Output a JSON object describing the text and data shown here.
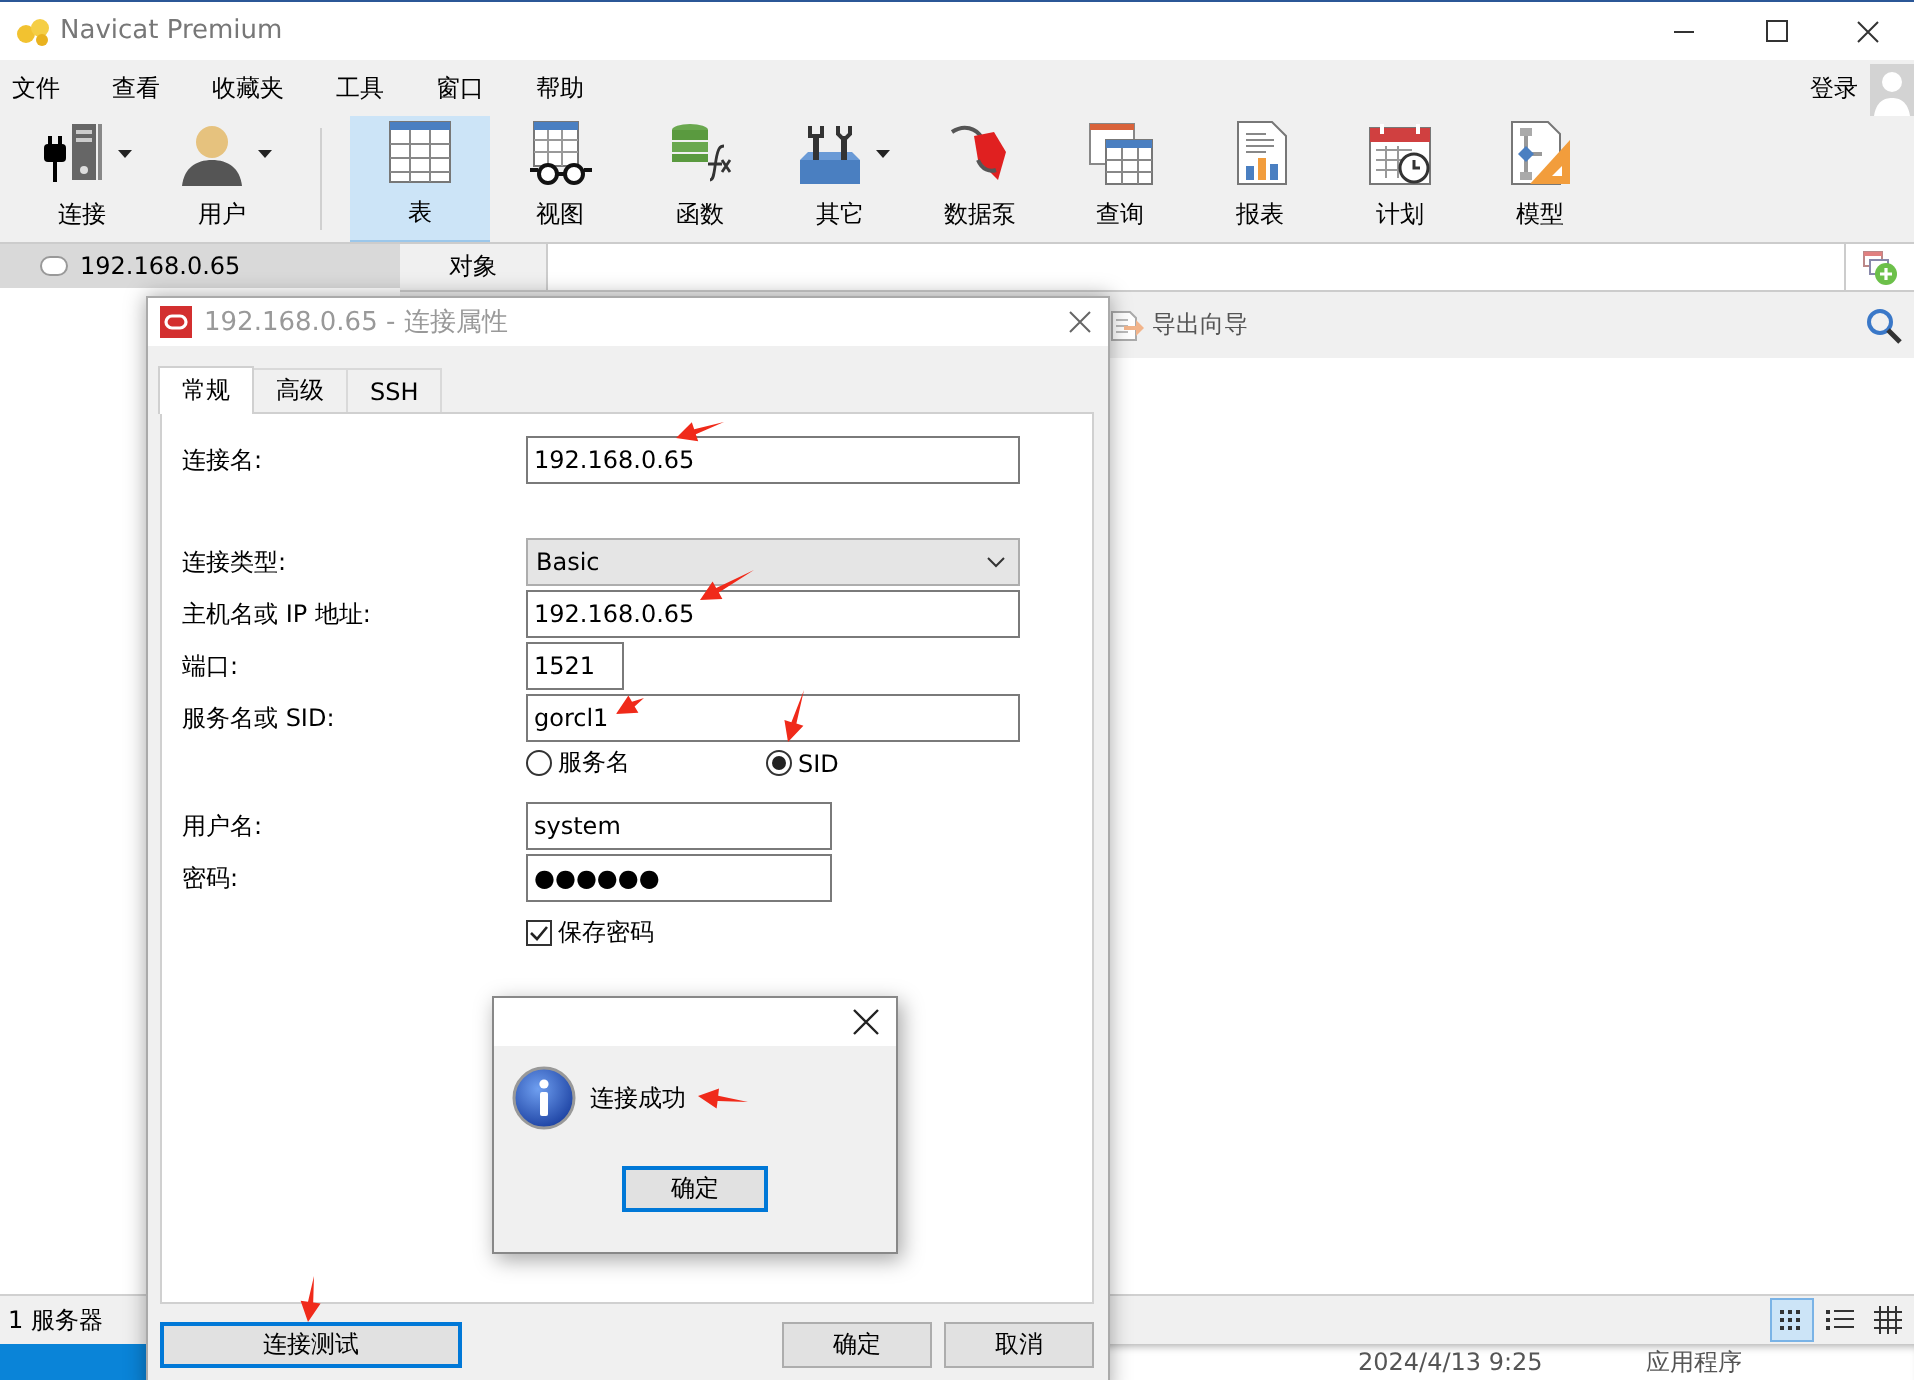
{
  "window": {
    "title": "Navicat Premium"
  },
  "menu": [
    "文件",
    "查看",
    "收藏夹",
    "工具",
    "窗口",
    "帮助"
  ],
  "login": "登录",
  "toolbar": [
    {
      "label": "连接",
      "dropdown": true,
      "selected": false
    },
    {
      "label": "用户",
      "dropdown": true,
      "selected": false
    },
    {
      "label": "表",
      "dropdown": false,
      "selected": true
    },
    {
      "label": "视图",
      "dropdown": false,
      "selected": false
    },
    {
      "label": "函数",
      "dropdown": false,
      "selected": false
    },
    {
      "label": "其它",
      "dropdown": true,
      "selected": false
    },
    {
      "label": "数据泵",
      "dropdown": false,
      "selected": false
    },
    {
      "label": "查询",
      "dropdown": false,
      "selected": false
    },
    {
      "label": "报表",
      "dropdown": false,
      "selected": false
    },
    {
      "label": "计划",
      "dropdown": false,
      "selected": false
    },
    {
      "label": "模型",
      "dropdown": false,
      "selected": false
    }
  ],
  "sidebar": {
    "items": [
      {
        "label": "192.168.0.65",
        "selected": true
      }
    ]
  },
  "object_tabs": [
    {
      "label": "对象",
      "selected": true
    }
  ],
  "object_toolbar": {
    "export_wizard": "导出向导"
  },
  "status_bar": {
    "text": "1 服务器",
    "view_modes": [
      {
        "selected": true
      },
      {
        "selected": false
      },
      {
        "selected": false
      }
    ]
  },
  "background_list": {
    "rows": [
      {
        "column_1": "2024/4/13 9:25",
        "column_2": "应用程序"
      }
    ]
  },
  "dialog": {
    "title": "192.168.0.65 - 连接属性",
    "tabs": [
      {
        "label": "常规",
        "selected": true
      },
      {
        "label": "高级",
        "selected": false
      },
      {
        "label": "SSH",
        "selected": false
      }
    ],
    "groups": [
      [
        {
          "kind": "text",
          "label": "连接名:",
          "value": "192.168.0.65"
        }
      ],
      [
        {
          "kind": "select",
          "label": "连接类型:",
          "value": "Basic"
        },
        {
          "kind": "text",
          "label": "主机名或 IP 地址:",
          "value": "192.168.0.65"
        },
        {
          "kind": "short",
          "label": "端口:",
          "value": "1521"
        },
        {
          "kind": "text",
          "label": "服务名或 SID:",
          "value": "gorcl1"
        },
        {
          "kind": "radio",
          "options": [
            {
              "label": "服务名",
              "selected": false
            },
            {
              "label": "SID",
              "selected": true
            }
          ]
        }
      ],
      [
        {
          "kind": "medium",
          "label": "用户名:",
          "value": "system"
        },
        {
          "kind": "medium",
          "label": "密码:",
          "value": "●●●●●●"
        },
        {
          "kind": "checkbox",
          "label": "保存密码",
          "checked": true
        }
      ]
    ],
    "test_button": "连接测试",
    "buttons": [
      "确定",
      "取消"
    ]
  },
  "message": {
    "text": "连接成功",
    "button": "确定"
  }
}
